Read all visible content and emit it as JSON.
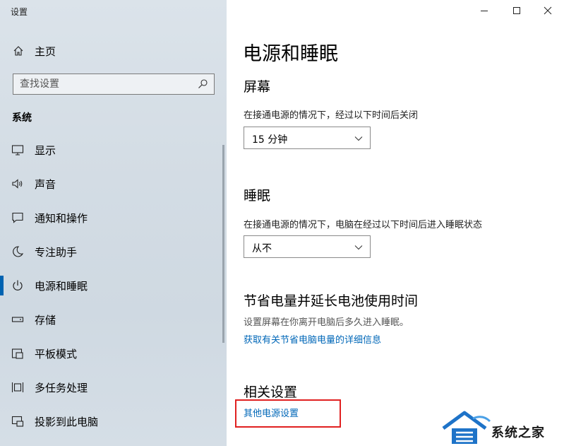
{
  "window": {
    "title": "设置"
  },
  "sidebar": {
    "home_label": "主页",
    "search_placeholder": "查找设置",
    "section_heading": "系统",
    "items": [
      {
        "label": "显示",
        "icon": "monitor-icon"
      },
      {
        "label": "声音",
        "icon": "speaker-icon"
      },
      {
        "label": "通知和操作",
        "icon": "notification-icon"
      },
      {
        "label": "专注助手",
        "icon": "moon-icon"
      },
      {
        "label": "电源和睡眠",
        "icon": "power-icon",
        "active": true
      },
      {
        "label": "存储",
        "icon": "storage-icon"
      },
      {
        "label": "平板模式",
        "icon": "tablet-icon"
      },
      {
        "label": "多任务处理",
        "icon": "multitask-icon"
      },
      {
        "label": "投影到此电脑",
        "icon": "project-icon"
      }
    ]
  },
  "main": {
    "title": "电源和睡眠",
    "screen": {
      "heading": "屏幕",
      "description": "在接通电源的情况下，经过以下时间后关闭",
      "selected": "15 分钟"
    },
    "sleep": {
      "heading": "睡眠",
      "description": "在接通电源的情况下，电脑在经过以下时间后进入睡眠状态",
      "selected": "从不"
    },
    "battery": {
      "heading": "节省电量并延长电池使用时间",
      "description": "设置屏幕在你离开电脑后多久进入睡眠。",
      "link": "获取有关节省电脑电量的详细信息"
    },
    "related": {
      "heading": "相关设置",
      "link": "其他电源设置"
    }
  },
  "watermark": {
    "text": "系统之家"
  },
  "colors": {
    "accent": "#0063b1",
    "link": "#0067b8",
    "highlight": "#e02020"
  }
}
